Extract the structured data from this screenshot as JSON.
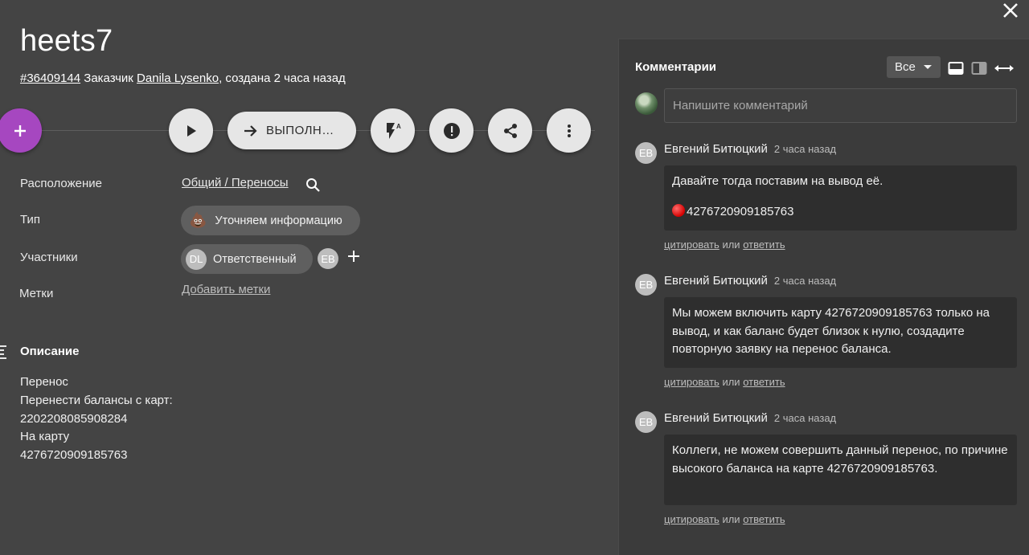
{
  "task": {
    "title": "heets7",
    "id_link": "#36409144",
    "customer_prefix": "Заказчик",
    "customer_name": "Danila Lysenko",
    "created_suffix": ", создана 2 часа назад"
  },
  "actions": {
    "add_icon": "plus-icon",
    "play_icon": "play-icon",
    "status_label": "ВЫПОЛН…",
    "status_icon": "arrow-right-icon",
    "priority_icon": "flash-auto-icon",
    "alert_icon": "alert-circle-icon",
    "share_icon": "share-icon",
    "more_icon": "more-vert-icon"
  },
  "properties": {
    "location_label": "Расположение",
    "location_value": "Общий / Переносы",
    "type_label": "Тип",
    "type_value": "Уточняем информацию",
    "type_emoji": "💩",
    "participants_label": "Участники",
    "responsible_initials": "DL",
    "responsible_label": "Ответственный",
    "participant_initials": "EB",
    "tags_label": "Метки",
    "add_tags": "Добавить метки"
  },
  "description": {
    "title": "Описание",
    "lines": [
      "Перенос",
      "Перенести балансы с карт:",
      "2202208085908284",
      "На карту",
      "4276720909185763"
    ]
  },
  "comments_panel": {
    "title": "Комментарии",
    "filter_value": "Все",
    "input_placeholder": "Напишите комментарий",
    "quote_label": "цитировать",
    "or_label": "или",
    "reply_label": "ответить",
    "comments": [
      {
        "initials": "EB",
        "author": "Евгений Битюцкий",
        "time": "2 часа назад",
        "line1": "Давайте тогда поставим на вывод её.",
        "line2": "4276720909185763"
      },
      {
        "initials": "EB",
        "author": "Евгений Битюцкий",
        "time": "2 часа назад",
        "text": "Мы можем включить карту 4276720909185763 только на вывод, и как баланс будет близок к нулю, создадите повторную заявку на перенос баланса."
      },
      {
        "initials": "EB",
        "author": "Евгений Битюцкий",
        "time": "2 часа назад",
        "text": "Коллеги, не можем совершить данный перенос, по причине высокого баланса на карте 4276720909185763."
      }
    ]
  },
  "colors": {
    "background": "#444444",
    "panel": "#3b3b3b",
    "accent": "#a647c0",
    "button": "#e6e6e6"
  }
}
